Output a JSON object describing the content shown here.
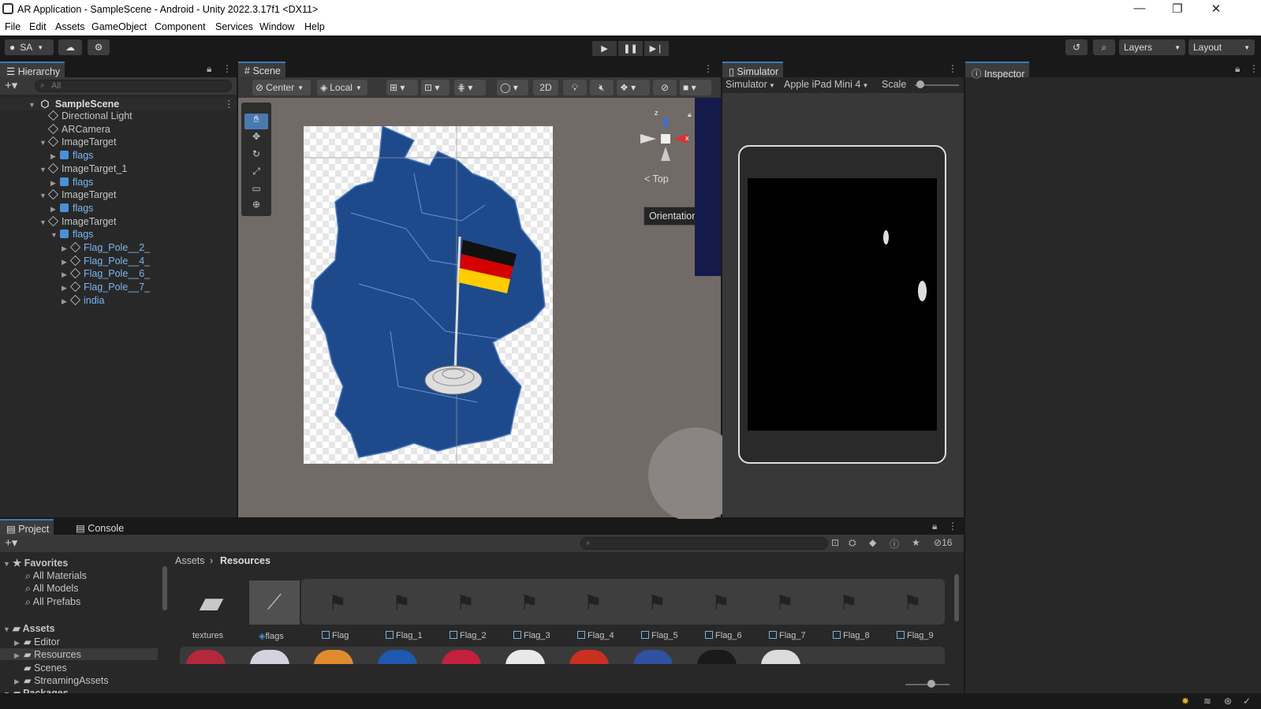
{
  "window": {
    "title": "AR Application - SampleScene - Android - Unity 2022.3.17f1 <DX11>",
    "controls": [
      "—",
      "❐",
      "✕"
    ]
  },
  "menu": [
    "File",
    "Edit",
    "Assets",
    "GameObject",
    "Component",
    "Services",
    "Window",
    "Help"
  ],
  "toolbar": {
    "account": "SA",
    "layers": "Layers",
    "layout": "Layout"
  },
  "hierarchy": {
    "tab": "Hierarchy",
    "search_placeholder": "All",
    "scene": "SampleScene",
    "items": [
      {
        "label": "Directional Light",
        "depth": 1,
        "type": "go"
      },
      {
        "label": "ARCamera",
        "depth": 1,
        "type": "go"
      },
      {
        "label": "ImageTarget",
        "depth": 1,
        "type": "go",
        "expanded": true
      },
      {
        "label": "flags",
        "depth": 2,
        "type": "prefab"
      },
      {
        "label": "ImageTarget_1",
        "depth": 1,
        "type": "go",
        "expanded": true
      },
      {
        "label": "flags",
        "depth": 2,
        "type": "prefab"
      },
      {
        "label": "ImageTarget",
        "depth": 1,
        "type": "go",
        "expanded": true
      },
      {
        "label": "flags",
        "depth": 2,
        "type": "prefab"
      },
      {
        "label": "ImageTarget",
        "depth": 1,
        "type": "go",
        "expanded": true
      },
      {
        "label": "flags",
        "depth": 2,
        "type": "prefab",
        "expanded": true
      },
      {
        "label": "Flag_Pole__2_",
        "depth": 3,
        "type": "child"
      },
      {
        "label": "Flag_Pole__4_",
        "depth": 3,
        "type": "child"
      },
      {
        "label": "Flag_Pole__6_",
        "depth": 3,
        "type": "child"
      },
      {
        "label": "Flag_Pole__7_",
        "depth": 3,
        "type": "child"
      },
      {
        "label": "india",
        "depth": 3,
        "type": "child"
      }
    ]
  },
  "scene": {
    "tab": "Scene",
    "pivot": "Center",
    "space": "Local",
    "mode2d": "2D",
    "gizmo_label": "Top",
    "tooltip": "Orientation",
    "axis_x": "x",
    "axis_z": "z"
  },
  "simulator": {
    "tab": "Simulator",
    "mode": "Simulator",
    "device": "Apple iPad Mini 4",
    "scale_label": "Scale"
  },
  "inspector": {
    "tab": "Inspector"
  },
  "project": {
    "tabs": [
      "Project",
      "Console"
    ],
    "hidden_count": "16",
    "tree": {
      "favorites": "Favorites",
      "favorite_items": [
        "All Materials",
        "All Models",
        "All Prefabs"
      ],
      "assets": "Assets",
      "asset_items": [
        "Editor",
        "Resources",
        "Scenes",
        "StreamingAssets"
      ],
      "packages": "Packages"
    },
    "breadcrumb": [
      "Assets",
      "Resources"
    ],
    "grid": [
      "textures",
      "flags",
      "Flag",
      "Flag_1",
      "Flag_2",
      "Flag_3",
      "Flag_4",
      "Flag_5",
      "Flag_6",
      "Flag_7",
      "Flag_8",
      "Flag_9"
    ]
  }
}
